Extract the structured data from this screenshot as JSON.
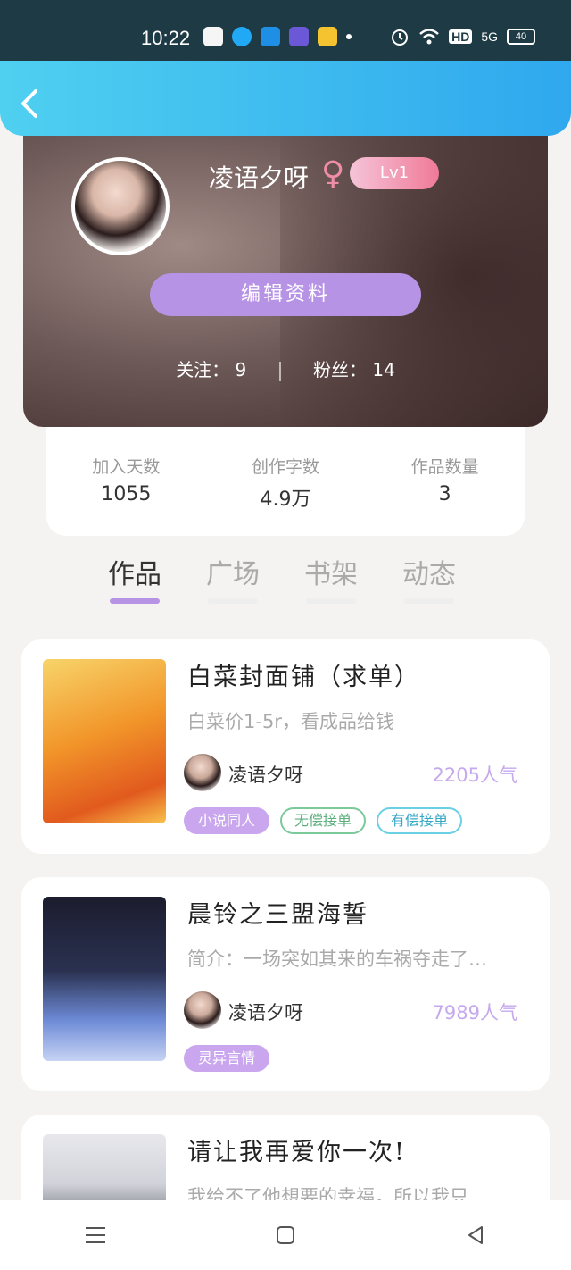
{
  "status_bar": {
    "time": "10:22",
    "network": "HD",
    "signal": "5G",
    "battery": "40"
  },
  "header": {
    "back_icon": "chevron-left-icon"
  },
  "profile": {
    "username": "凌语夕呀",
    "gender_symbol": "♀",
    "level": "Lv1",
    "edit_button": "编辑资料",
    "following_label": "关注：",
    "following_count": "9",
    "followers_label": "粉丝：",
    "followers_count": "14"
  },
  "stats": [
    {
      "label": "加入天数",
      "value": "1055"
    },
    {
      "label": "创作字数",
      "value": "4.9万"
    },
    {
      "label": "作品数量",
      "value": "3"
    }
  ],
  "tabs": [
    {
      "label": "作品",
      "active": true
    },
    {
      "label": "广场",
      "active": false
    },
    {
      "label": "书架",
      "active": false
    },
    {
      "label": "动态",
      "active": false
    }
  ],
  "works": [
    {
      "title": "白菜封面铺（求单）",
      "description": "白菜价1-5r，看成品给钱",
      "author": "凌语夕呀",
      "popularity": "2205人气",
      "tags": [
        {
          "label": "小说同人",
          "style": "purple"
        },
        {
          "label": "无偿接单",
          "style": "green"
        },
        {
          "label": "有偿接单",
          "style": "cyan"
        }
      ]
    },
    {
      "title": "晨铃之三盟海誓",
      "description": "简介：一场突如其来的车祸夺走了…",
      "author": "凌语夕呀",
      "popularity": "7989人气",
      "tags": [
        {
          "label": "灵异言情",
          "style": "purple"
        }
      ]
    },
    {
      "title": "请让我再爱你一次!",
      "description": "我给不了他想要的幸福，所以我只…",
      "author": "",
      "popularity": "",
      "tags": []
    }
  ],
  "navbar": {
    "menu_icon": "menu-icon",
    "home_icon": "home-square-icon",
    "back_icon": "back-triangle-icon"
  }
}
